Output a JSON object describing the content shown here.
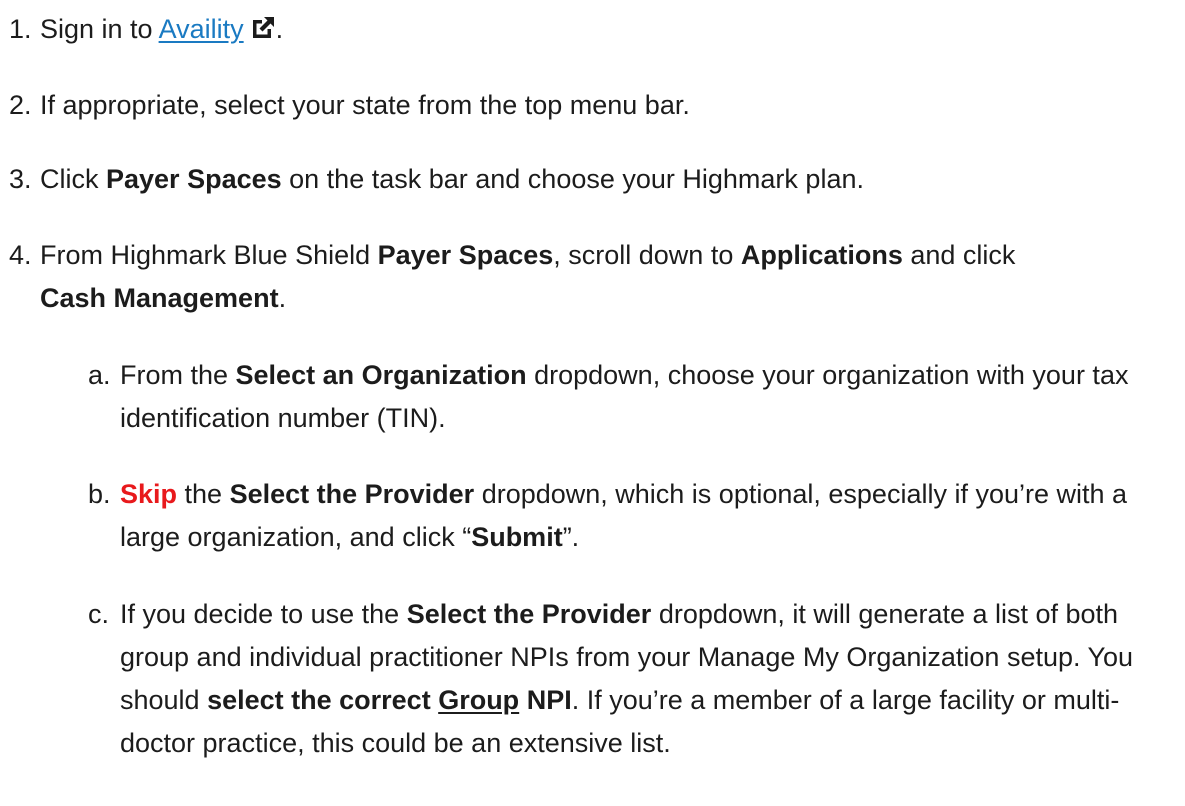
{
  "steps": [
    {
      "num": "1.",
      "pre": "Sign in to ",
      "link": "Availity",
      "icon": "external-link-icon",
      "post": "."
    },
    {
      "num": "2.",
      "text": "If appropriate, select your state from the top menu bar."
    },
    {
      "num": "3.",
      "pre": "Click ",
      "bold1": "Payer Spaces",
      "post": " on the task bar and choose your Highmark plan."
    },
    {
      "num": "4.",
      "pre": "From Highmark Blue Shield ",
      "bold1": "Payer Spaces",
      "mid1": ", scroll down to ",
      "bold2": "Applications",
      "mid2": " and click ",
      "bold3": "Cash Management",
      "post": "."
    }
  ],
  "substeps": [
    {
      "num": "a.",
      "pre": "From the ",
      "bold1": "Select an Organization",
      "post": " dropdown, choose your organization with your tax identification number (TIN)."
    },
    {
      "num": "b.",
      "red": "Skip",
      "mid1": " the ",
      "bold1": "Select the Provider",
      "mid2": " dropdown, which is optional, especially if you’re with a large organization, and click “",
      "bold2": "Submit",
      "post": "”."
    },
    {
      "num": "c.",
      "pre": "If you decide to use the ",
      "bold1": "Select the Provider",
      "mid1": " dropdown, it will generate a list of both group and individual practitioner NPIs from your Manage My Organization setup. You should ",
      "bold2": "select the correct ",
      "bold_underline": "Group",
      "bold3": " NPI",
      "post": ". If you’re a member of a large facility or multi-doctor practice, this could be an extensive list."
    }
  ],
  "colors": {
    "text": "#1c1c1c",
    "link": "#1a7ac2",
    "emphasis_red": "#e8191c"
  }
}
